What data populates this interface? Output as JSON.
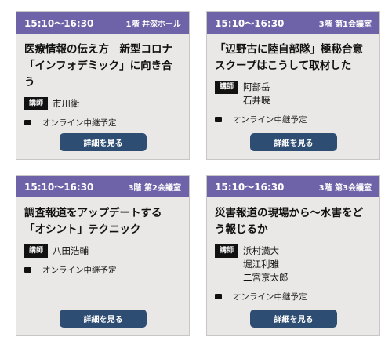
{
  "sessions": [
    {
      "time": "15:10～16:30",
      "room": "1階 井深ホール",
      "title": "医療情報の伝え方　新型コロナ「インフォデミック」に向き合う",
      "speaker_label": "講師",
      "speakers": [
        "市川衛"
      ],
      "online": "オンライン中継予定",
      "button": "詳細を見る"
    },
    {
      "time": "15:10～16:30",
      "room": "3階 第1会議室",
      "title": "「辺野古に陸自部隊」極秘合意スクープはこうして取材した",
      "speaker_label": "講師",
      "speakers": [
        "阿部岳",
        "石井暁"
      ],
      "online": "オンライン中継予定",
      "button": "詳細を見る"
    },
    {
      "time": "15:10～16:30",
      "room": "3階 第2会議室",
      "title": "調査報道をアップデートする「オシント」テクニック",
      "speaker_label": "講師",
      "speakers": [
        "八田浩輔"
      ],
      "online": "オンライン中継予定",
      "button": "詳細を見る"
    },
    {
      "time": "15:10～16:30",
      "room": "3階 第3会議室",
      "title": "災害報道の現場から～水害をどう報じるか",
      "speaker_label": "講師",
      "speakers": [
        "浜村満大",
        "堀江利雅",
        "二宮京太郎"
      ],
      "online": "オンライン中継予定",
      "button": "詳細を見る"
    }
  ],
  "colors": {
    "header": "#6e63a8",
    "card_bg": "#eae8e6",
    "button": "#2e4d73"
  }
}
